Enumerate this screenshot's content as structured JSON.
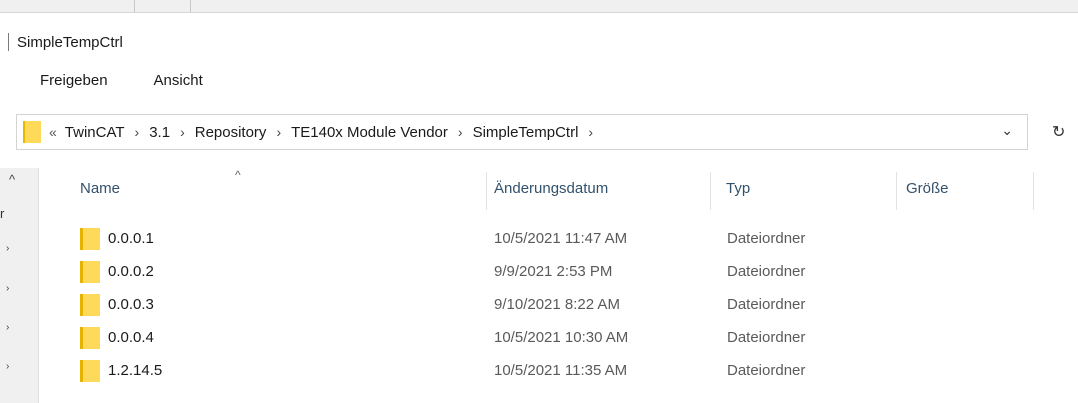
{
  "window": {
    "title": "SimpleTempCtrl"
  },
  "ribbon": {
    "tabs": [
      "Freigeben",
      "Ansicht"
    ]
  },
  "address": {
    "overflow": "«",
    "crumbs": [
      "TwinCAT",
      "3.1",
      "Repository",
      "TE140x Module Vendor",
      "SimpleTempCtrl"
    ],
    "separator": "›",
    "dropdown_icon": "chevron-down",
    "refresh_icon": "refresh"
  },
  "nav": {
    "partial_label": "r",
    "up_icon": "chevron-up"
  },
  "columns": {
    "name": "Name",
    "date": "Änderungsdatum",
    "type": "Typ",
    "size": "Größe"
  },
  "files": [
    {
      "name": "0.0.0.1",
      "date": "10/5/2021 11:47 AM",
      "type": "Dateiordner"
    },
    {
      "name": "0.0.0.2",
      "date": "9/9/2021 2:53 PM",
      "type": "Dateiordner"
    },
    {
      "name": "0.0.0.3",
      "date": "9/10/2021 8:22 AM",
      "type": "Dateiordner"
    },
    {
      "name": "0.0.0.4",
      "date": "10/5/2021 10:30 AM",
      "type": "Dateiordner"
    },
    {
      "name": "1.2.14.5",
      "date": "10/5/2021 11:35 AM",
      "type": "Dateiordner"
    }
  ],
  "colors": {
    "folder": "#ffd95a",
    "folder_edge": "#e6b400",
    "header_text": "#33516b"
  }
}
